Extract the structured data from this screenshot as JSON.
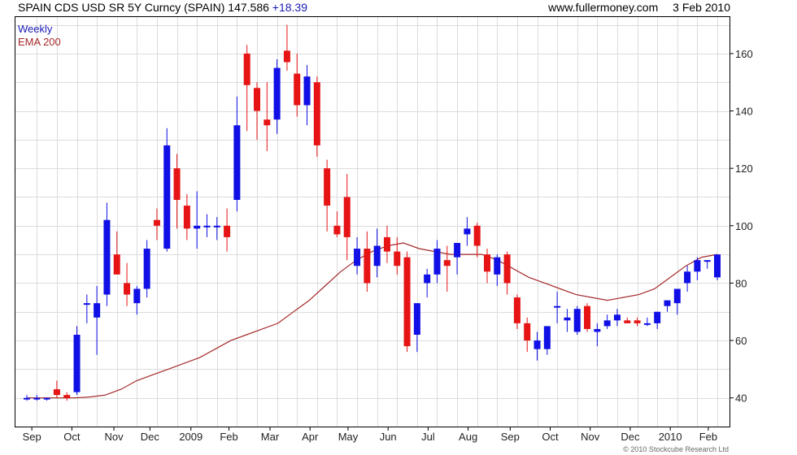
{
  "header": {
    "title": "SPAIN CDS USD SR 5Y Curncy (SPAIN)",
    "last": "147.586",
    "change": "+18.39",
    "source": "www.fullermoney.com",
    "date": "3 Feb 2010"
  },
  "footer": {
    "copyright": "© 2010 Stockcube Research Ltd"
  },
  "colors": {
    "up": "#1010e6",
    "down": "#e61414",
    "ema": "#a52a2a",
    "grid": "#dcdcdc",
    "frame": "#000000"
  },
  "chart_data": {
    "type": "candlestick",
    "frequency": "weekly",
    "legend": [
      {
        "label": "Weekly",
        "color": "#1a1ab5"
      },
      {
        "label": "EMA 200",
        "color": "#a52a2a"
      }
    ],
    "y_ticks": [
      40,
      60,
      80,
      100,
      120,
      140,
      160
    ],
    "y_range": [
      30,
      173
    ],
    "x_labels": [
      "Sep",
      "Oct",
      "Nov",
      "Dec",
      "2009",
      "Feb",
      "Mar",
      "Apr",
      "May",
      "Jun",
      "Jul",
      "Aug",
      "Sep",
      "Oct",
      "Nov",
      "Dec",
      "2010",
      "Feb"
    ],
    "x_label_index": [
      0.5,
      4.5,
      8.7,
      12.3,
      16.4,
      20.2,
      24.3,
      28.3,
      32.1,
      36.1,
      40.1,
      44.1,
      48.3,
      52.3,
      56.3,
      60.3,
      64.3,
      68.1
    ],
    "candles": [
      [
        40,
        41,
        39,
        40
      ],
      [
        40,
        41,
        39,
        40
      ],
      [
        40,
        40,
        39,
        40
      ],
      [
        43,
        46,
        40,
        41
      ],
      [
        41,
        42,
        39,
        40
      ],
      [
        42,
        65,
        41,
        62
      ],
      [
        73,
        76,
        66,
        73
      ],
      [
        68,
        79,
        55,
        73
      ],
      [
        76,
        108,
        72,
        102
      ],
      [
        90,
        98,
        83,
        83
      ],
      [
        80,
        87,
        72,
        76
      ],
      [
        73,
        79,
        69,
        78
      ],
      [
        78,
        95,
        75,
        92
      ],
      [
        102,
        106,
        95,
        100
      ],
      [
        92,
        134,
        91,
        128
      ],
      [
        120,
        125,
        99,
        109
      ],
      [
        107,
        111,
        95,
        99
      ],
      [
        99,
        112,
        92,
        100
      ],
      [
        100,
        104,
        96,
        100
      ],
      [
        100,
        103,
        95,
        100
      ],
      [
        100,
        106,
        91,
        96
      ],
      [
        109,
        145,
        105,
        135
      ],
      [
        160,
        163,
        133,
        149
      ],
      [
        148,
        150,
        130,
        140
      ],
      [
        137,
        150,
        126,
        135
      ],
      [
        137,
        158,
        132,
        155
      ],
      [
        161,
        170,
        154,
        157
      ],
      [
        153,
        160,
        138,
        142
      ],
      [
        142,
        156,
        135,
        152
      ],
      [
        150,
        152,
        124,
        128
      ],
      [
        120,
        123,
        98,
        107
      ],
      [
        100,
        105,
        96,
        97
      ],
      [
        110,
        118,
        88,
        96
      ],
      [
        86,
        96,
        83,
        92
      ],
      [
        92,
        98,
        77,
        80
      ],
      [
        86,
        99,
        82,
        93
      ],
      [
        96,
        100,
        87,
        91
      ],
      [
        91,
        96,
        83,
        86
      ],
      [
        89,
        91,
        56,
        58
      ],
      [
        62,
        73,
        56,
        73
      ],
      [
        80,
        85,
        75,
        83
      ],
      [
        83,
        95,
        80,
        92
      ],
      [
        88,
        93,
        77,
        86
      ],
      [
        89,
        94,
        83,
        94
      ],
      [
        97,
        103,
        93,
        99
      ],
      [
        100,
        101,
        89,
        93
      ],
      [
        90,
        92,
        80,
        84
      ],
      [
        83,
        90,
        79,
        89
      ],
      [
        90,
        91,
        76,
        80
      ],
      [
        75,
        76,
        64,
        66
      ],
      [
        66,
        68,
        56,
        60
      ],
      [
        57,
        63,
        53,
        60
      ],
      [
        57,
        65,
        55,
        65
      ],
      [
        72,
        77,
        66,
        72
      ],
      [
        67,
        71,
        63,
        68
      ],
      [
        63,
        72,
        62,
        71
      ],
      [
        72,
        73,
        63,
        64
      ],
      [
        63,
        66,
        58,
        64
      ],
      [
        65,
        69,
        64,
        67
      ],
      [
        67,
        71,
        65,
        69
      ],
      [
        67,
        68,
        66,
        66
      ],
      [
        67,
        68,
        65,
        66
      ],
      [
        66,
        68,
        65,
        66
      ],
      [
        66,
        70,
        64,
        70
      ],
      [
        72,
        74,
        70,
        74
      ],
      [
        73,
        78,
        69,
        78
      ],
      [
        80,
        86,
        77,
        84
      ],
      [
        84,
        89,
        81,
        88
      ],
      [
        88,
        88,
        85,
        88
      ],
      [
        82,
        90,
        81,
        90
      ]
    ],
    "ema200": [
      40,
      40,
      40,
      40,
      40.3,
      41,
      43,
      46,
      48,
      50,
      52,
      54,
      57,
      60,
      62,
      64,
      66,
      70,
      74,
      79,
      84,
      88,
      91,
      93,
      94,
      92,
      91,
      90,
      90,
      90,
      88,
      85,
      82,
      80,
      78,
      76,
      75,
      74,
      75,
      76,
      78,
      82,
      86,
      89,
      90
    ],
    "ylabel": "",
    "xlabel": ""
  }
}
